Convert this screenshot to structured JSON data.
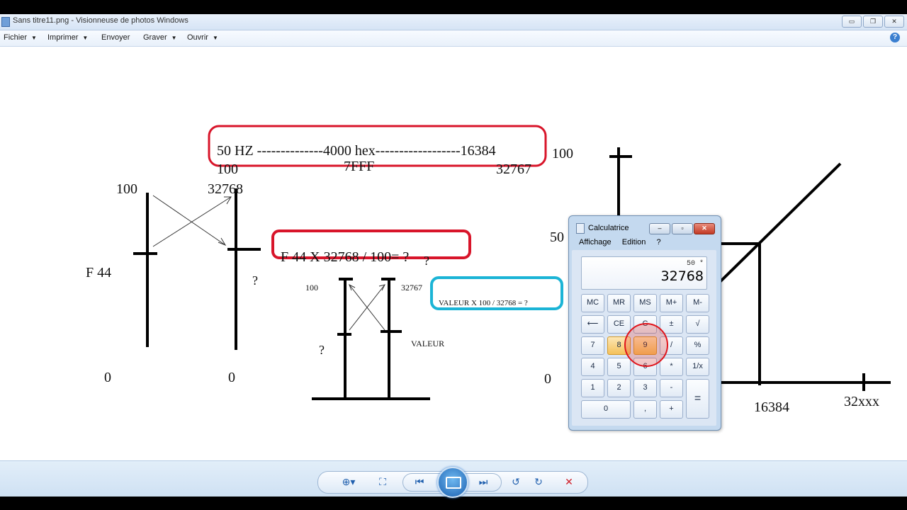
{
  "window": {
    "title": "Sans titre11.png - Visionneuse de photos Windows",
    "controls": [
      "▭",
      "❐",
      "✕"
    ]
  },
  "menubar": {
    "items": [
      "Fichier",
      "Imprimer",
      "Envoyer",
      "Graver",
      "Ouvrir"
    ],
    "help": "?"
  },
  "drawing": {
    "box1": {
      "row1": "50  HZ  --------------4000 hex------------------16384",
      "row2_left": "100",
      "row2_mid": "7FFF",
      "row2_right": "32767"
    },
    "box2": {
      "text": "F 44  X 32768 / 100= ?",
      "extra": "?"
    },
    "box3": {
      "text": "VALEUR  X  100  /  32768  = ?"
    },
    "left_graph": {
      "top_left": "100",
      "top_right": "32768",
      "mid_left": "F 44",
      "mid_right": "?",
      "bottom_left": "0",
      "bottom_right": "0"
    },
    "mid_graph": {
      "top_left": "100",
      "top_right": "32767",
      "mid_left": "?",
      "mid_right": "VALEUR"
    },
    "right_graph": {
      "y_top": "100",
      "y_mid": "50",
      "y_zero": "0",
      "x_mid": "16384",
      "x_end": "32xxx"
    }
  },
  "calculator": {
    "title": "Calculatrice",
    "menu": [
      "Affichage",
      "Edition",
      "?"
    ],
    "history": "50 *",
    "value": "32768",
    "keys": {
      "mc": "MC",
      "mr": "MR",
      "ms": "MS",
      "mplus": "M+",
      "mminus": "M-",
      "back": "⟵",
      "ce": "CE",
      "c": "C",
      "plusminus": "±",
      "sqrt": "√",
      "k7": "7",
      "k8": "8",
      "k9": "9",
      "div": "/",
      "pct": "%",
      "k4": "4",
      "k5": "5",
      "k6": "6",
      "mul": "*",
      "inv": "1/x",
      "k1": "1",
      "k2": "2",
      "k3": "3",
      "minus": "-",
      "eq": "=",
      "k0": "0",
      "dot": ",",
      "plus": "+"
    }
  },
  "toolbar": {
    "zoom": "⊕▾",
    "fit": "⛶",
    "prev": "⏮",
    "next": "⏭",
    "rotate_ccw": "↺",
    "rotate_cw": "↻",
    "delete": "✕"
  }
}
